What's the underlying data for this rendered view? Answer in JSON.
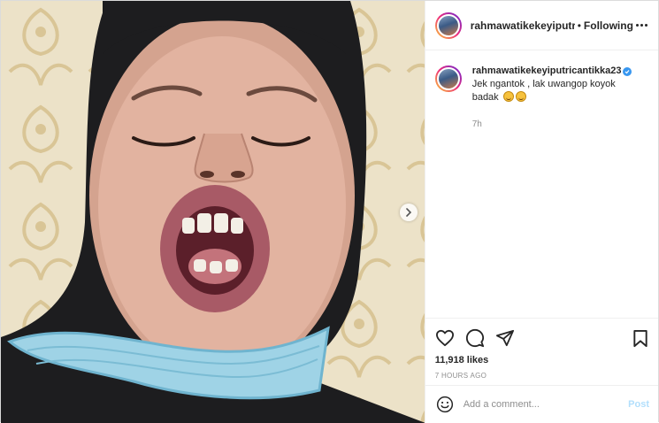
{
  "header": {
    "username": "rahmawatikekeyiputric",
    "separator": "•",
    "follow_status": "Following"
  },
  "caption": {
    "username": "rahmawatikekeyiputricantikka23",
    "text": "Jek ngantok , lak uwangop koyok badak",
    "emojis": [
      "grinning-face",
      "grinning-sweat-face"
    ],
    "time": "7h"
  },
  "stats": {
    "likes": "11,918 likes",
    "posted": "7 HOURS AGO"
  },
  "add_comment": {
    "placeholder": "Add a comment...",
    "post_label": "Post"
  },
  "colors": {
    "link_blue": "#3897f0",
    "post_disabled": "#b2dffc",
    "muted": "#8e8e8e"
  },
  "icons": [
    "heart-icon",
    "comment-icon",
    "share-icon",
    "bookmark-icon",
    "more-icon",
    "smiley-icon",
    "chevron-right-icon",
    "verified-badge-icon"
  ]
}
